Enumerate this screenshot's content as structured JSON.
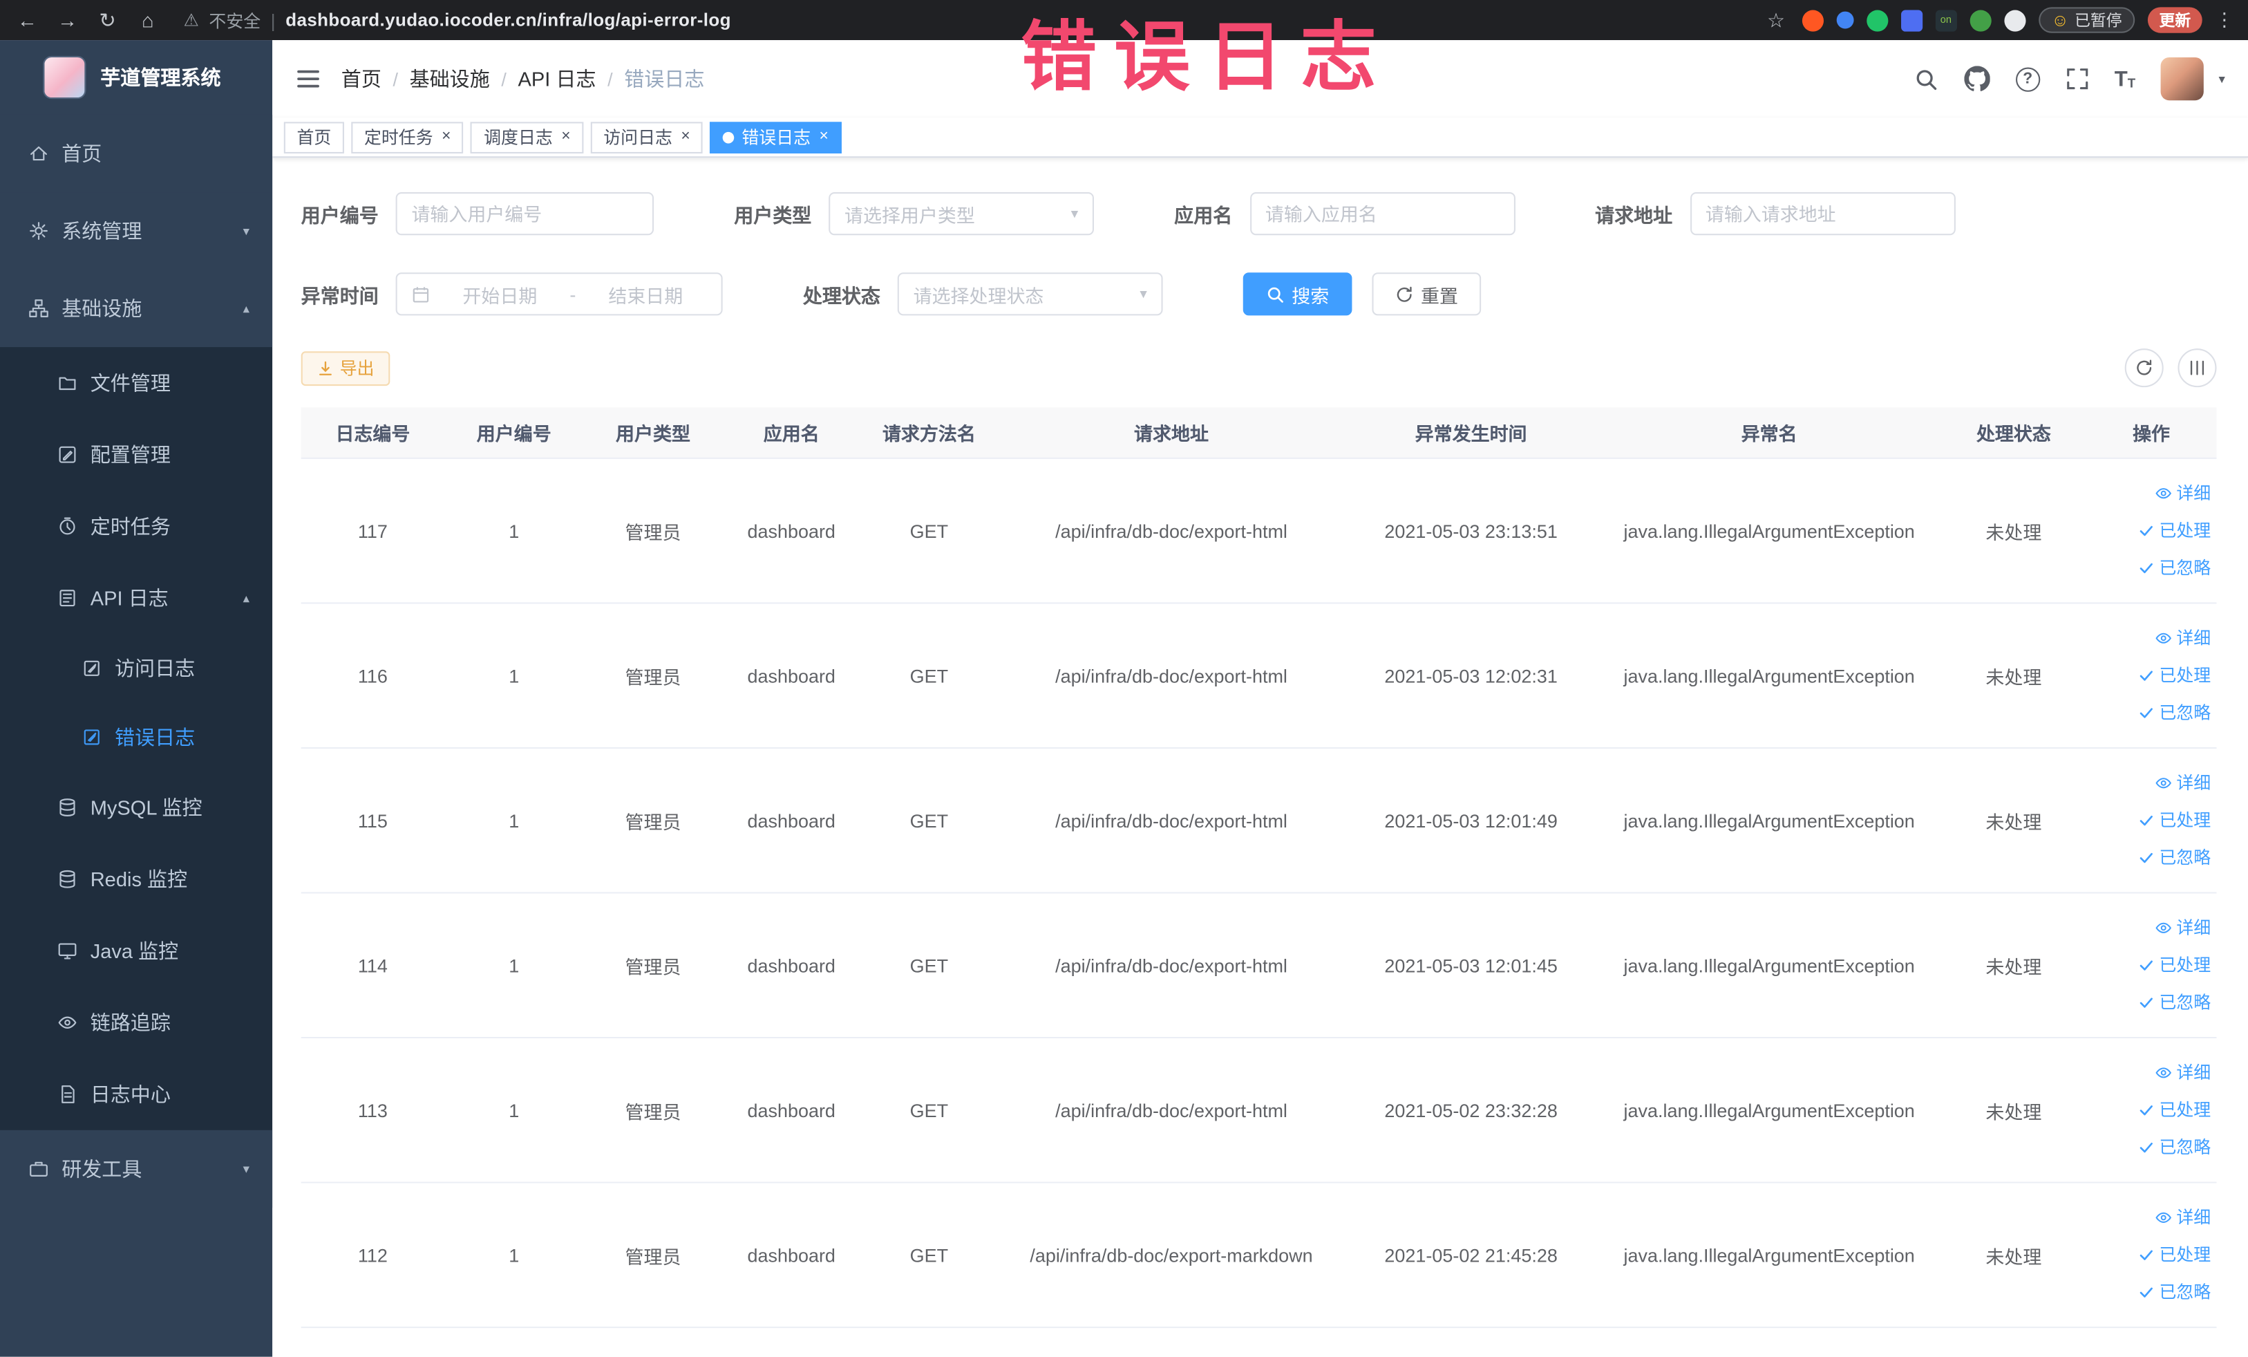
{
  "browser": {
    "security_label": "不安全",
    "url": "dashboard.yudao.iocoder.cn/infra/log/api-error-log",
    "paused_badge": "已暂停",
    "update_label": "更新"
  },
  "annotation": {
    "text": "错误日志",
    "color": "#f2486e"
  },
  "sidebar": {
    "logo_title": "芋道管理系统",
    "items": [
      {
        "key": "home",
        "label": "首页",
        "icon": "home-icon",
        "level": 1
      },
      {
        "key": "system-management",
        "label": "系统管理",
        "icon": "gear-icon",
        "level": 1,
        "chevron": "down"
      },
      {
        "key": "infrastructure",
        "label": "基础设施",
        "icon": "infra-icon",
        "level": 1,
        "chevron": "up"
      },
      {
        "key": "file-management",
        "label": "文件管理",
        "icon": "file-icon",
        "level": 2
      },
      {
        "key": "config-management",
        "label": "配置管理",
        "icon": "config-icon",
        "level": 2
      },
      {
        "key": "scheduled-jobs",
        "label": "定时任务",
        "icon": "timer-icon",
        "level": 2
      },
      {
        "key": "api-log",
        "label": "API 日志",
        "icon": "api-log-icon",
        "level": 2,
        "chevron": "up"
      },
      {
        "key": "access-log",
        "label": "访问日志",
        "icon": "doc-icon",
        "level": 3
      },
      {
        "key": "error-log",
        "label": "错误日志",
        "icon": "doc-icon",
        "level": 3,
        "active": true
      },
      {
        "key": "mysql-monitor",
        "label": "MySQL 监控",
        "icon": "db-icon",
        "level": 2
      },
      {
        "key": "redis-monitor",
        "label": "Redis 监控",
        "icon": "db-icon",
        "level": 2
      },
      {
        "key": "java-monitor",
        "label": "Java 监控",
        "icon": "monitor-icon",
        "level": 2
      },
      {
        "key": "trace",
        "label": "链路追踪",
        "icon": "eye-icon",
        "level": 2
      },
      {
        "key": "log-center",
        "label": "日志中心",
        "icon": "log-icon",
        "level": 2
      },
      {
        "key": "dev-tools",
        "label": "研发工具",
        "icon": "tool-icon",
        "level": 1,
        "chevron": "down"
      }
    ]
  },
  "header": {
    "breadcrumb": [
      "首页",
      "基础设施",
      "API 日志",
      "错误日志"
    ]
  },
  "tabs": [
    {
      "label": "首页",
      "closable": false,
      "active": false
    },
    {
      "label": "定时任务",
      "closable": true,
      "active": false
    },
    {
      "label": "调度日志",
      "closable": true,
      "active": false
    },
    {
      "label": "访问日志",
      "closable": true,
      "active": false
    },
    {
      "label": "错误日志",
      "closable": true,
      "active": true
    }
  ],
  "filters": {
    "user_id": {
      "label": "用户编号",
      "placeholder": "请输入用户编号"
    },
    "user_type": {
      "label": "用户类型",
      "placeholder": "请选择用户类型"
    },
    "app_name": {
      "label": "应用名",
      "placeholder": "请输入应用名"
    },
    "request_url": {
      "label": "请求地址",
      "placeholder": "请输入请求地址"
    },
    "exception_time": {
      "label": "异常时间",
      "start_placeholder": "开始日期",
      "separator": "-",
      "end_placeholder": "结束日期"
    },
    "process_status": {
      "label": "处理状态",
      "placeholder": "请选择处理状态"
    },
    "search_button": "搜索",
    "reset_button": "重置"
  },
  "toolbar": {
    "export_button": "导出"
  },
  "table": {
    "columns": [
      "日志编号",
      "用户编号",
      "用户类型",
      "应用名",
      "请求方法名",
      "请求地址",
      "异常发生时间",
      "异常名",
      "处理状态",
      "操作"
    ],
    "actions": [
      "详细",
      "已处理",
      "已忽略"
    ],
    "rows": [
      {
        "id": "117",
        "user_id": "1",
        "user_type": "管理员",
        "app": "dashboard",
        "method": "GET",
        "url": "/api/infra/db-doc/export-html",
        "time": "2021-05-03 23:13:51",
        "exception": "java.lang.IllegalArgumentException",
        "status": "未处理"
      },
      {
        "id": "116",
        "user_id": "1",
        "user_type": "管理员",
        "app": "dashboard",
        "method": "GET",
        "url": "/api/infra/db-doc/export-html",
        "time": "2021-05-03 12:02:31",
        "exception": "java.lang.IllegalArgumentException",
        "status": "未处理"
      },
      {
        "id": "115",
        "user_id": "1",
        "user_type": "管理员",
        "app": "dashboard",
        "method": "GET",
        "url": "/api/infra/db-doc/export-html",
        "time": "2021-05-03 12:01:49",
        "exception": "java.lang.IllegalArgumentException",
        "status": "未处理"
      },
      {
        "id": "114",
        "user_id": "1",
        "user_type": "管理员",
        "app": "dashboard",
        "method": "GET",
        "url": "/api/infra/db-doc/export-html",
        "time": "2021-05-03 12:01:45",
        "exception": "java.lang.IllegalArgumentException",
        "status": "未处理"
      },
      {
        "id": "113",
        "user_id": "1",
        "user_type": "管理员",
        "app": "dashboard",
        "method": "GET",
        "url": "/api/infra/db-doc/export-html",
        "time": "2021-05-02 23:32:28",
        "exception": "java.lang.IllegalArgumentException",
        "status": "未处理"
      },
      {
        "id": "112",
        "user_id": "1",
        "user_type": "管理员",
        "app": "dashboard",
        "method": "GET",
        "url": "/api/infra/db-doc/export-markdown",
        "time": "2021-05-02 21:45:28",
        "exception": "java.lang.IllegalArgumentException",
        "status": "未处理"
      }
    ]
  }
}
